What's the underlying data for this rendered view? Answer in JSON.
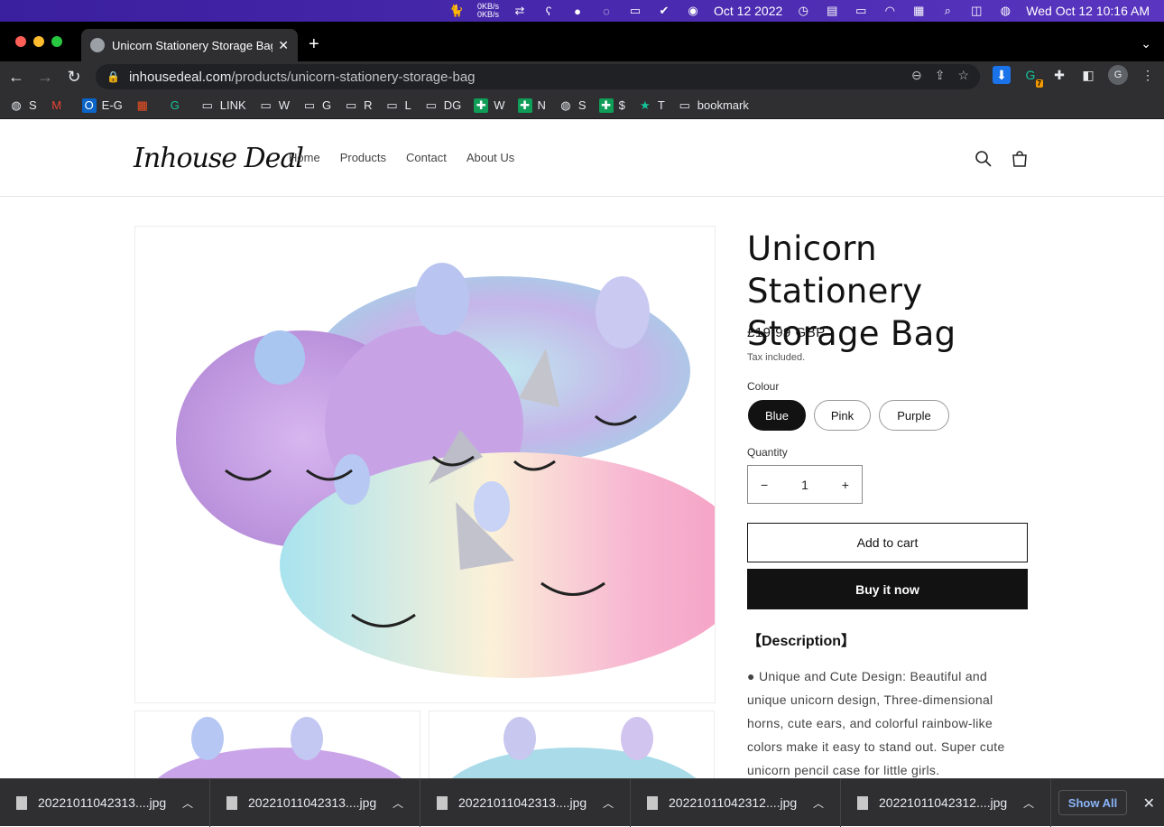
{
  "menubar": {
    "net_up": "0KB/s",
    "net_down": "0KB/s",
    "date_label": "Oct 12 2022",
    "clock": "Wed Oct 12  10:16 AM"
  },
  "browser": {
    "tab_title": "Unicorn Stationery Storage Bag",
    "url_host": "inhousedeal.com",
    "url_path": "/products/unicorn-stationery-storage-bag",
    "profile_initial": "G",
    "ext_badge": "7",
    "bookmarks": [
      {
        "label": "S",
        "icon": "globe-icon"
      },
      {
        "label": "",
        "icon": "gmail-icon"
      },
      {
        "label": "E-G",
        "icon": "outlook-icon"
      },
      {
        "label": "",
        "icon": "microsoft-icon"
      },
      {
        "label": "",
        "icon": "grammarly-icon"
      },
      {
        "label": "LINK",
        "icon": "folder-icon"
      },
      {
        "label": "W",
        "icon": "folder-icon"
      },
      {
        "label": "G",
        "icon": "folder-icon"
      },
      {
        "label": "R",
        "icon": "folder-icon"
      },
      {
        "label": "L",
        "icon": "folder-icon"
      },
      {
        "label": "DG",
        "icon": "folder-icon"
      },
      {
        "label": "W",
        "icon": "sheets-icon"
      },
      {
        "label": "N",
        "icon": "sheets-icon"
      },
      {
        "label": "S",
        "icon": "globe-icon"
      },
      {
        "label": "$",
        "icon": "sheets-icon"
      },
      {
        "label": "T",
        "icon": "star-icon"
      },
      {
        "label": "bookmark",
        "icon": "folder-icon"
      }
    ]
  },
  "site": {
    "logo": "Inhouse Deal",
    "nav": [
      "Home",
      "Products",
      "Contact",
      "About Us"
    ]
  },
  "product": {
    "title": "Unicorn Stationery Storage Bag",
    "price": "£19.99 GBP",
    "tax_note": "Tax included.",
    "colour_label": "Colour",
    "colours": [
      "Blue",
      "Pink",
      "Purple"
    ],
    "selected_colour": "Blue",
    "quantity_label": "Quantity",
    "quantity": "1",
    "add_to_cart": "Add to cart",
    "buy_now": "Buy it now",
    "description_heading": "【Description】",
    "description": "● Unique and Cute Design: Beautiful and unique unicorn design, Three-dimensional horns, cute ears, and colorful rainbow-like colors make it easy to stand out. Super cute unicorn pencil case for little girls."
  },
  "downloads": {
    "items": [
      "20221011042313....jpg",
      "20221011042313....jpg",
      "20221011042313....jpg",
      "20221011042312....jpg",
      "20221011042312....jpg"
    ],
    "show_all": "Show All"
  },
  "colors": {
    "accent": "#121212",
    "menubar": "#3a1f9e",
    "link_blue": "#8ab4f8"
  }
}
